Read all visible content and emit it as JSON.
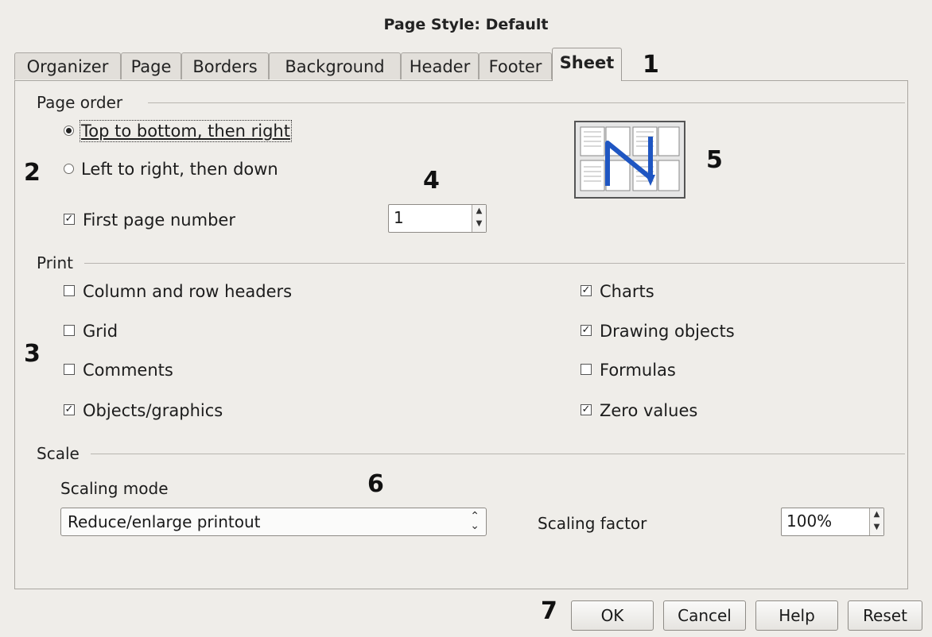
{
  "window": {
    "title": "Page Style: Default"
  },
  "tabs": [
    "Organizer",
    "Page",
    "Borders",
    "Background",
    "Header",
    "Footer",
    "Sheet"
  ],
  "active_tab": "Sheet",
  "callouts": [
    "1",
    "2",
    "3",
    "4",
    "5",
    "6",
    "7"
  ],
  "page_order": {
    "heading": "Page order",
    "options": [
      {
        "label": "Top to bottom, then right",
        "selected": true
      },
      {
        "label": "Left to right, then down",
        "selected": false
      }
    ],
    "first_page_number": {
      "label": "First page number",
      "checked": true,
      "value": "1"
    }
  },
  "print": {
    "heading": "Print",
    "left": [
      {
        "label": "Column and row headers",
        "checked": false
      },
      {
        "label": "Grid",
        "checked": false
      },
      {
        "label": "Comments",
        "checked": false
      },
      {
        "label": "Objects/graphics",
        "checked": true
      }
    ],
    "right": [
      {
        "label": "Charts",
        "checked": true
      },
      {
        "label": "Drawing objects",
        "checked": true
      },
      {
        "label": "Formulas",
        "checked": false
      },
      {
        "label": "Zero values",
        "checked": true
      }
    ]
  },
  "scale": {
    "heading": "Scale",
    "mode_label": "Scaling mode",
    "mode_value": "Reduce/enlarge printout",
    "factor_label": "Scaling factor",
    "factor_value": "100%"
  },
  "buttons": {
    "ok": "OK",
    "cancel": "Cancel",
    "help": "Help",
    "reset": "Reset"
  },
  "icons": {
    "preview": "page-order-preview-icon",
    "check": "✓"
  }
}
